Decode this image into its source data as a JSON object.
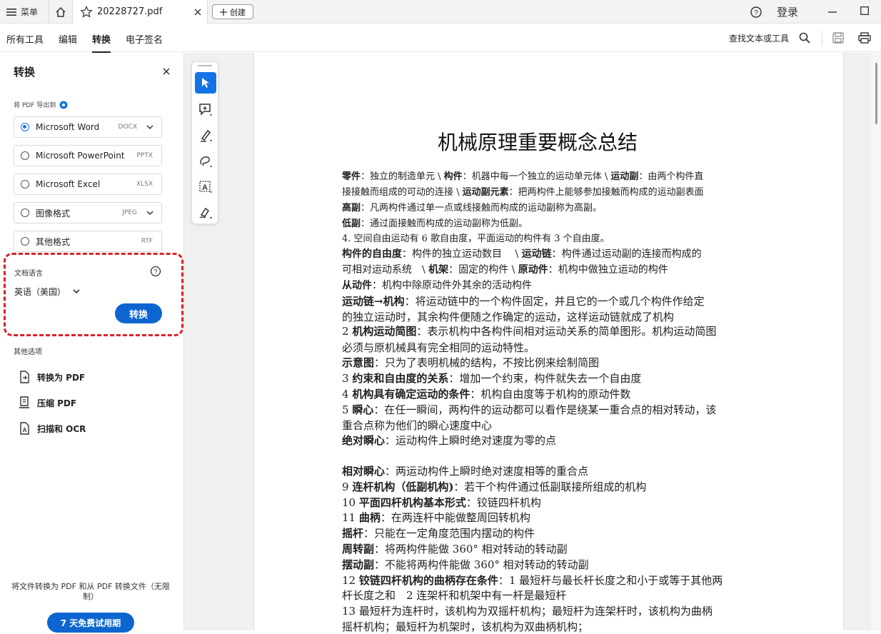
{
  "titlebar": {
    "menu_label": "菜单",
    "tab_title": "20228727.pdf",
    "create_label": "创建",
    "login_label": "登录"
  },
  "menubar": {
    "items": [
      "所有工具",
      "编辑",
      "转换",
      "电子签名"
    ],
    "active": "转换",
    "find_label": "查找文本或工具"
  },
  "panel": {
    "title": "转换",
    "export_label": "将 PDF 导出到",
    "formats": [
      {
        "label": "Microsoft Word",
        "ext": "DOCX",
        "selected": true
      },
      {
        "label": "Microsoft PowerPoint",
        "ext": "PPTX",
        "selected": false
      },
      {
        "label": "Microsoft Excel",
        "ext": "XLSX",
        "selected": false
      },
      {
        "label": "图像格式",
        "ext": "JPEG",
        "selected": false
      },
      {
        "label": "其他格式",
        "ext": "RTF",
        "selected": false
      }
    ],
    "doc_lang_label": "文档语言",
    "doc_lang_value": "英语（美国）",
    "convert_button": "转换",
    "other_options_label": "其他选项",
    "other_options": [
      "转换为 PDF",
      "压缩 PDF",
      "扫描和 OCR"
    ],
    "promo_text": "将文件转换为 PDF 和从 PDF 转换文件（无限制）",
    "trial_button": "7 天免费试用期"
  },
  "colors": {
    "accent": "#1473e6",
    "convert_button": "#0d66d0",
    "highlight_dash": "#d9222a"
  },
  "document": {
    "title": "机械原理重要概念总结",
    "lines": [
      [
        [
          "b",
          "零件"
        ],
        [
          "t",
          "：独立的制造单元 \\ "
        ],
        [
          "b",
          "构件"
        ],
        [
          "t",
          "：机器中每一个独立的运动单元体 \\ "
        ],
        [
          "b",
          "运动副"
        ],
        [
          "t",
          "：由两个构件直"
        ]
      ],
      [
        [
          "t",
          "接接触而组成的可动的连接 \\ "
        ],
        [
          "b",
          "运动副元素"
        ],
        [
          "t",
          "：把两构件上能够参加接触而构成的运动副表面"
        ]
      ],
      [
        [
          "b",
          "高副"
        ],
        [
          "t",
          "：凡两构件通过单一点或线接触而构成的运动副称为高副。"
        ]
      ],
      [
        [
          "b",
          "低副"
        ],
        [
          "t",
          "：通过面接触而构成的运动副称为低副。"
        ]
      ],
      [
        [
          "t",
          "4. 空间自由运动有 6 歌自由度，平面运动的构件有 3 个自由度。"
        ]
      ],
      [
        [
          "b",
          "构件的自由度"
        ],
        [
          "t",
          "：构件的独立运动数目　 \\ "
        ],
        [
          "b",
          "运动链"
        ],
        [
          "t",
          "：构件通过运动副的连接而构成的"
        ]
      ],
      [
        [
          "t",
          "可相对运动系统　\\ "
        ],
        [
          "b",
          "机架"
        ],
        [
          "t",
          "：固定的构件 \\ "
        ],
        [
          "b",
          "原动件"
        ],
        [
          "t",
          "：机构中做独立运动的构件"
        ]
      ],
      [
        [
          "b",
          " 从动件"
        ],
        [
          "t",
          "：机构中除原动件外其余的活动构件"
        ]
      ],
      [
        [
          "b",
          " 运动链→机构"
        ],
        [
          "t",
          "：将运动链中的一个构件固定，并且它的一个或几个构件作给定"
        ]
      ],
      [
        [
          "t",
          "的独立运动时，其余构件便随之作确定的运动，这样运动链就成了机构"
        ]
      ],
      [
        [
          "t",
          "2 "
        ],
        [
          "b",
          "机构运动简图"
        ],
        [
          "t",
          "：表示机构中各构件间相对运动关系的简单图形。机构运动简图"
        ]
      ],
      [
        [
          "t",
          "必须与原机械具有完全相同的运动特性。"
        ]
      ],
      [
        [
          "b",
          "  示意图"
        ],
        [
          "t",
          "：只为了表明机械的结构，不按比例来绘制简图"
        ]
      ],
      [
        [
          "t",
          "3 "
        ],
        [
          "b",
          "约束和自由度的关系"
        ],
        [
          "t",
          "：增加一个约束，构件就失去一个自由度"
        ]
      ],
      [
        [
          "t",
          "4 "
        ],
        [
          "b",
          "机构具有确定运动的条件"
        ],
        [
          "t",
          "：机构自由度等于机构的原动件数"
        ]
      ],
      [
        [
          "t",
          "5 "
        ],
        [
          "b",
          "瞬心"
        ],
        [
          "t",
          "：在任一瞬间，两构件的运动都可以看作是绕某一重合点的相对转动，该"
        ]
      ],
      [
        [
          "t",
          "重合点称为他们的瞬心速度中心"
        ]
      ],
      [
        [
          "b",
          "  绝对瞬心"
        ],
        [
          "t",
          "：运动构件上瞬时绝对速度为零的点"
        ]
      ],
      [
        [
          "b",
          "相对瞬心"
        ],
        [
          "t",
          "：两运动构件上瞬时绝对速度相等的重合点"
        ]
      ],
      [
        [
          "t",
          "9 "
        ],
        [
          "b",
          "连杆机构（低副机构)"
        ],
        [
          "t",
          "：若干个构件通过低副联接所组成的机构"
        ]
      ],
      [
        [
          "t",
          "10 "
        ],
        [
          "b",
          "平面四杆机构基本形式"
        ],
        [
          "t",
          "：铰链四杆机构"
        ]
      ],
      [
        [
          "t",
          "11 "
        ],
        [
          "b",
          "曲柄"
        ],
        [
          "t",
          "：在两连杆中能做整周回转机构"
        ]
      ],
      [
        [
          "b",
          "   摇杆"
        ],
        [
          "t",
          "：只能在一定角度范围内摆动的构件"
        ]
      ],
      [
        [
          "b",
          "   周转副"
        ],
        [
          "t",
          "：将两构件能做 360°  相对转动的转动副"
        ]
      ],
      [
        [
          "b",
          " 摆动副"
        ],
        [
          "t",
          "：不能将两构件能做 360°  相对转动的转动副"
        ]
      ],
      [
        [
          "t",
          "12 "
        ],
        [
          "b",
          "铰链四杆机构的曲柄存在条件"
        ],
        [
          "t",
          "：1 最短杆与最长杆长度之和小于或等于其他两"
        ]
      ],
      [
        [
          "t",
          "杆长度之和　2 连架杆和机架中有一杆是最短杆"
        ]
      ],
      [
        [
          "t",
          "13 最短杆为连杆时，该机构为双摇杆机构；最短杆为连架杆时，该机构为曲柄"
        ]
      ],
      [
        [
          "t",
          "摇杆机构；最短杆为机架时，该机构为双曲柄机构；"
        ]
      ]
    ]
  }
}
